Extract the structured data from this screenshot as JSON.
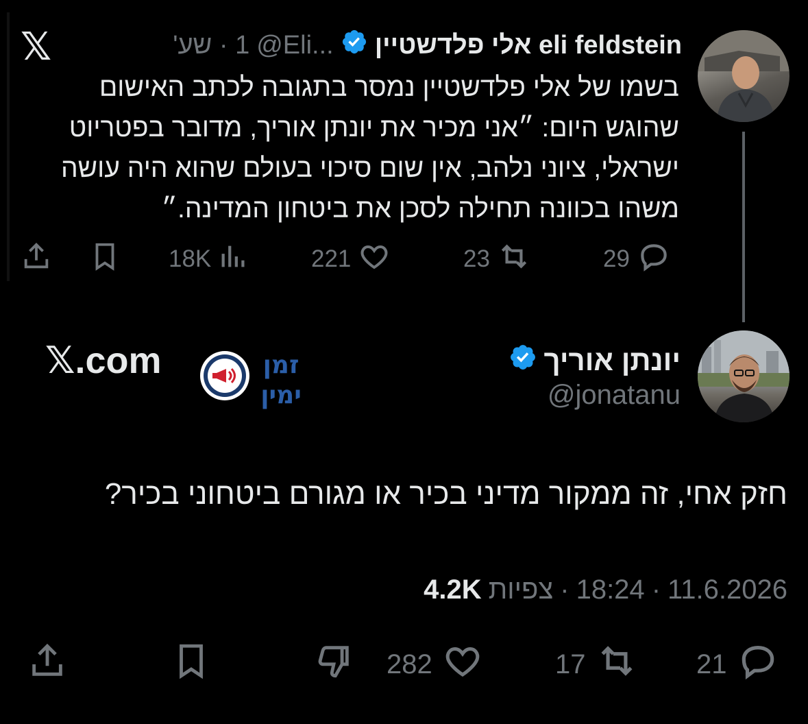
{
  "parent_tweet": {
    "display_name": "eli feldstein אלי פלדשטיין",
    "handle": "@Eli...",
    "time": "1 · שע'",
    "text_lines": [
      "בשמו של אלי פלדשטיין נמסר בתגובה לכתב האישום",
      "שהוגש היום: ״אני מכיר את יונתן אוריך, מדובר בפטריוט",
      "ישראלי, ציוני נלהב, אין שום סיכוי בעולם שהוא היה עושה",
      "משהו בכוונה תחילה לסכן את ביטחון המדינה.״"
    ],
    "replies": "29",
    "reposts": "23",
    "likes": "221",
    "views": "18K"
  },
  "main_tweet": {
    "display_name": "יונתן אוריך",
    "handle": "@jonatanu",
    "text": "חזק אחי, זה ממקור מדיני בכיר או מגורם ביטחוני בכיר?",
    "date": "11.6.2026",
    "time": "18:24",
    "views_label": "צפיות",
    "views": "4.2K",
    "replies": "21",
    "reposts": "17",
    "likes": "282"
  },
  "watermark": {
    "site": "𝕏.com",
    "logo_text_top": "זמן",
    "logo_text_bottom": "ימין"
  },
  "icons": {
    "x_logo": "𝕏",
    "verified": "verified-badge-icon"
  },
  "colors": {
    "background": "#000000",
    "text": "#e7e9ea",
    "muted": "#71767b",
    "verified": "#1d9bf0",
    "logo_navy": "#1b3a6b",
    "logo_red": "#d0202e"
  }
}
